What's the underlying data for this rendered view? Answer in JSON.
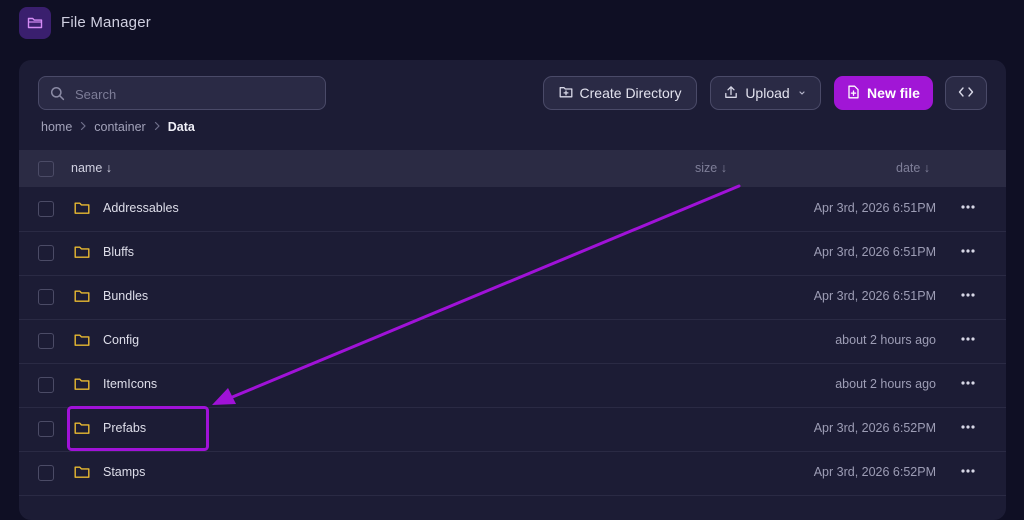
{
  "app": {
    "title": "File Manager"
  },
  "toolbar": {
    "search_placeholder": "Search",
    "create_directory_label": "Create Directory",
    "upload_label": "Upload",
    "new_file_label": "New file"
  },
  "breadcrumb": {
    "items": [
      "home",
      "container",
      "Data"
    ]
  },
  "table": {
    "headers": {
      "name": "name ↓",
      "size": "size ↓",
      "date": "date ↓"
    },
    "rows": [
      {
        "name": "Addressables",
        "date": "Apr 3rd, 2026 6:51PM"
      },
      {
        "name": "Bluffs",
        "date": "Apr 3rd, 2026 6:51PM"
      },
      {
        "name": "Bundles",
        "date": "Apr 3rd, 2026 6:51PM"
      },
      {
        "name": "Config",
        "date": "about 2 hours ago"
      },
      {
        "name": "ItemIcons",
        "date": "about 2 hours ago"
      },
      {
        "name": "Prefabs",
        "date": "Apr 3rd, 2026 6:52PM"
      },
      {
        "name": "Stamps",
        "date": "Apr 3rd, 2026 6:52PM"
      }
    ]
  },
  "colors": {
    "accent": "#a116d6",
    "annotation": "#a012d8",
    "folder": "#e8b931",
    "background": "#0f0f24",
    "panel": "#1c1c35"
  },
  "icons": [
    "folder-icon",
    "search-icon",
    "folder-plus-icon",
    "upload-icon",
    "chevron-down-icon",
    "file-plus-icon",
    "code-icon",
    "chevron-right-icon",
    "more-horizontal-icon"
  ]
}
